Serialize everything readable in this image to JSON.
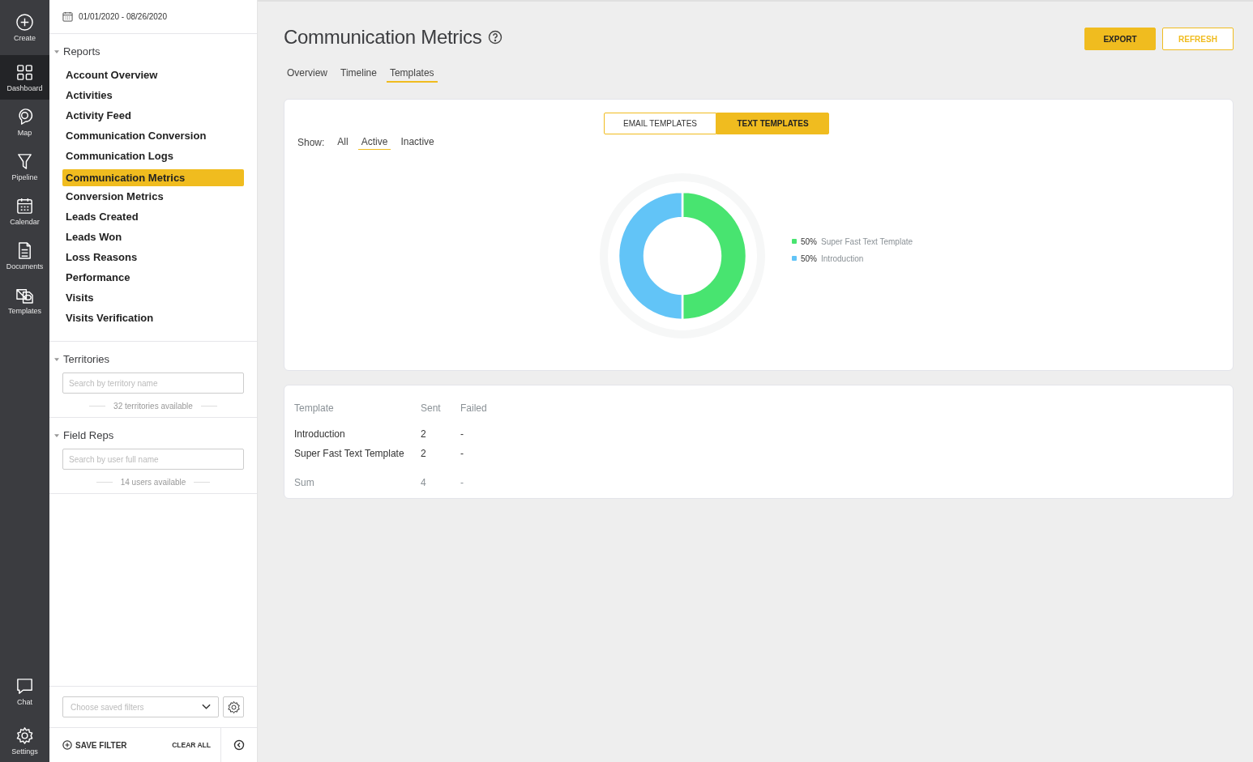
{
  "rail": {
    "top": [
      {
        "label": "Create",
        "kind": "plus",
        "selected": false
      },
      {
        "label": "Dashboard",
        "kind": "grid",
        "selected": true
      },
      {
        "label": "Map",
        "kind": "pin",
        "selected": false
      },
      {
        "label": "Pipeline",
        "kind": "funnel",
        "selected": false
      },
      {
        "label": "Calendar",
        "kind": "calendar",
        "selected": false
      },
      {
        "label": "Documents",
        "kind": "document",
        "selected": false
      },
      {
        "label": "Templates",
        "kind": "templates",
        "selected": false
      }
    ],
    "bottom": [
      {
        "label": "Chat",
        "kind": "chat",
        "selected": false
      },
      {
        "label": "Settings",
        "kind": "gear",
        "selected": false
      }
    ]
  },
  "sidebar": {
    "date_range": "01/01/2020 - 08/26/2020",
    "reports": {
      "title": "Reports",
      "expanded": true,
      "items": [
        {
          "label": "Account Overview",
          "selected": false
        },
        {
          "label": "Activities",
          "selected": false
        },
        {
          "label": "Activity Feed",
          "selected": false
        },
        {
          "label": "Communication Conversion",
          "selected": false
        },
        {
          "label": "Communication Logs",
          "selected": false
        },
        {
          "label": "Communication Metrics",
          "selected": true
        },
        {
          "label": "Conversion Metrics",
          "selected": false
        },
        {
          "label": "Leads Created",
          "selected": false
        },
        {
          "label": "Leads Won",
          "selected": false
        },
        {
          "label": "Loss Reasons",
          "selected": false
        },
        {
          "label": "Performance",
          "selected": false
        },
        {
          "label": "Visits",
          "selected": false
        },
        {
          "label": "Visits Verification",
          "selected": false
        }
      ]
    },
    "filters": [
      {
        "title": "Territories",
        "expanded": true,
        "placeholder": "Search by territory name",
        "count": "32 territories available"
      },
      {
        "title": "Field Reps",
        "expanded": true,
        "placeholder": "Search by user full name",
        "count": "14 users available"
      }
    ],
    "saved_filters": {
      "placeholder": "Choose saved filters"
    },
    "save_filter": "SAVE FILTER",
    "clear_all": "CLEAR ALL"
  },
  "main": {
    "title": "Communication Metrics",
    "buttons": [
      {
        "label": "EXPORT",
        "kind": "primary"
      },
      {
        "label": "REFRESH",
        "kind": "outline"
      }
    ],
    "tabs": [
      {
        "label": "Overview",
        "selected": false
      },
      {
        "label": "Timeline",
        "selected": false
      },
      {
        "label": "Templates",
        "selected": true
      }
    ],
    "template_types": [
      {
        "label": "EMAIL TEMPLATES",
        "selected": false
      },
      {
        "label": "TEXT TEMPLATES",
        "selected": true
      }
    ],
    "show_label": "Show:",
    "show_filters": [
      {
        "label": "All",
        "selected": false
      },
      {
        "label": "Active",
        "selected": true
      },
      {
        "label": "Inactive",
        "selected": false
      }
    ],
    "chart_data": {
      "type": "donut",
      "categories": [
        "Super Fast Text Template",
        "Introduction"
      ],
      "series": [
        {
          "values": [
            50,
            50
          ]
        }
      ]
    },
    "legend": [
      {
        "percent": "50%",
        "color": "#48e470"
      },
      {
        "percent": "50%",
        "color": "#62c4f7"
      }
    ],
    "table": {
      "columns": [
        "Template",
        "Sent",
        "Failed"
      ],
      "rows": [
        [
          "Introduction",
          "2",
          "-"
        ],
        [
          "Super Fast Text Template",
          "2",
          "-"
        ]
      ],
      "sum": [
        "Sum",
        "4",
        "-"
      ]
    }
  }
}
